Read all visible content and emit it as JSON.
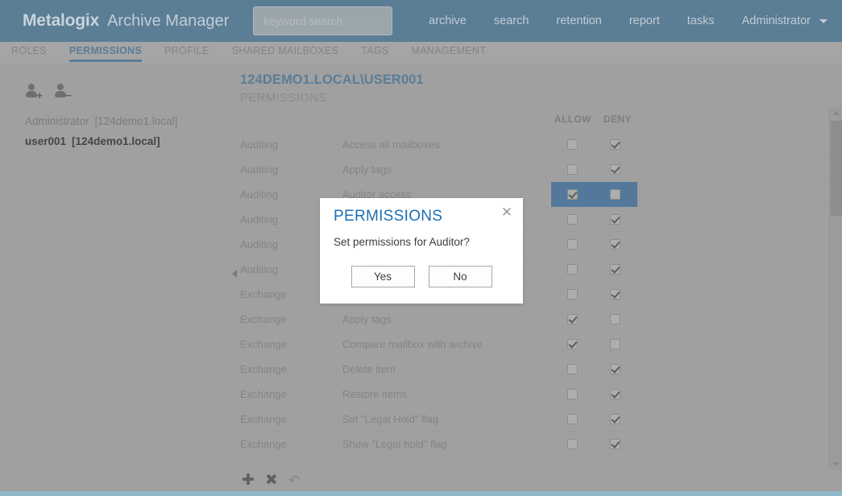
{
  "header": {
    "brand_name": "Metalogix",
    "product_name": "Archive Manager",
    "search_placeholder": "keyword search",
    "search_value": "",
    "nav": [
      {
        "label": "archive"
      },
      {
        "label": "search"
      },
      {
        "label": "retention"
      },
      {
        "label": "report"
      },
      {
        "label": "tasks"
      }
    ],
    "user_label": "Administrator"
  },
  "tabs": [
    {
      "label": "ROLES",
      "active": false
    },
    {
      "label": "PERMISSIONS",
      "active": true
    },
    {
      "label": "PROFILE",
      "active": false
    },
    {
      "label": "SHARED MAILBOXES",
      "active": false
    },
    {
      "label": "TAGS",
      "active": false
    },
    {
      "label": "MANAGEMENT",
      "active": false
    }
  ],
  "sidebar": {
    "add_user_icon": "add-user-icon",
    "add_user_sign": "+",
    "remove_user_icon": "remove-user-icon",
    "remove_user_sign": "−",
    "items": [
      {
        "name": "Administrator",
        "domain": "[124demo1.local]",
        "selected": false
      },
      {
        "name": "user001",
        "domain": "[124demo1.local]",
        "selected": true
      }
    ]
  },
  "main": {
    "title": "124DEMO1.LOCAL\\USER001",
    "subtitle": "PERMISSIONS",
    "columns": {
      "allow": "ALLOW",
      "deny": "DENY"
    },
    "rows": [
      {
        "category": "Auditing",
        "permission": "Access all mailboxes",
        "allow": false,
        "deny": true,
        "highlighted": false
      },
      {
        "category": "Auditing",
        "permission": "Apply tags",
        "allow": false,
        "deny": true,
        "highlighted": false
      },
      {
        "category": "Auditing",
        "permission": "Auditor access",
        "allow": true,
        "deny": false,
        "highlighted": true
      },
      {
        "category": "Auditing",
        "permission": "",
        "allow": false,
        "deny": true,
        "highlighted": false
      },
      {
        "category": "Auditing",
        "permission": "",
        "allow": false,
        "deny": true,
        "highlighted": false
      },
      {
        "category": "Auditing",
        "permission": "",
        "allow": false,
        "deny": true,
        "highlighted": false
      },
      {
        "category": "Exchange",
        "permission": "",
        "allow": false,
        "deny": true,
        "highlighted": false
      },
      {
        "category": "Exchange",
        "permission": "Apply tags",
        "allow": true,
        "deny": false,
        "highlighted": false
      },
      {
        "category": "Exchange",
        "permission": "Compare mailbox with archive",
        "allow": true,
        "deny": false,
        "highlighted": false
      },
      {
        "category": "Exchange",
        "permission": "Delete item",
        "allow": false,
        "deny": true,
        "highlighted": false
      },
      {
        "category": "Exchange",
        "permission": "Restore items",
        "allow": false,
        "deny": true,
        "highlighted": false
      },
      {
        "category": "Exchange",
        "permission": "Set \"Legal Hold\" flag",
        "allow": false,
        "deny": true,
        "highlighted": false
      },
      {
        "category": "Exchange",
        "permission": "Show \"Legal hold\" flag",
        "allow": false,
        "deny": true,
        "highlighted": false
      }
    ]
  },
  "footer": {
    "add_label": "✚",
    "delete_label": "✖",
    "undo_label": "↶"
  },
  "modal": {
    "title": "PERMISSIONS",
    "close_label": "✕",
    "message": "Set permissions for Auditor?",
    "yes_label": "Yes",
    "no_label": "No"
  },
  "colors": {
    "header_bg": "#5b7d96",
    "accent": "#5b7d96",
    "modal_title": "#1b6fb4",
    "row_highlight": "#53789b",
    "bottom_strip": "#8fb8c6"
  }
}
